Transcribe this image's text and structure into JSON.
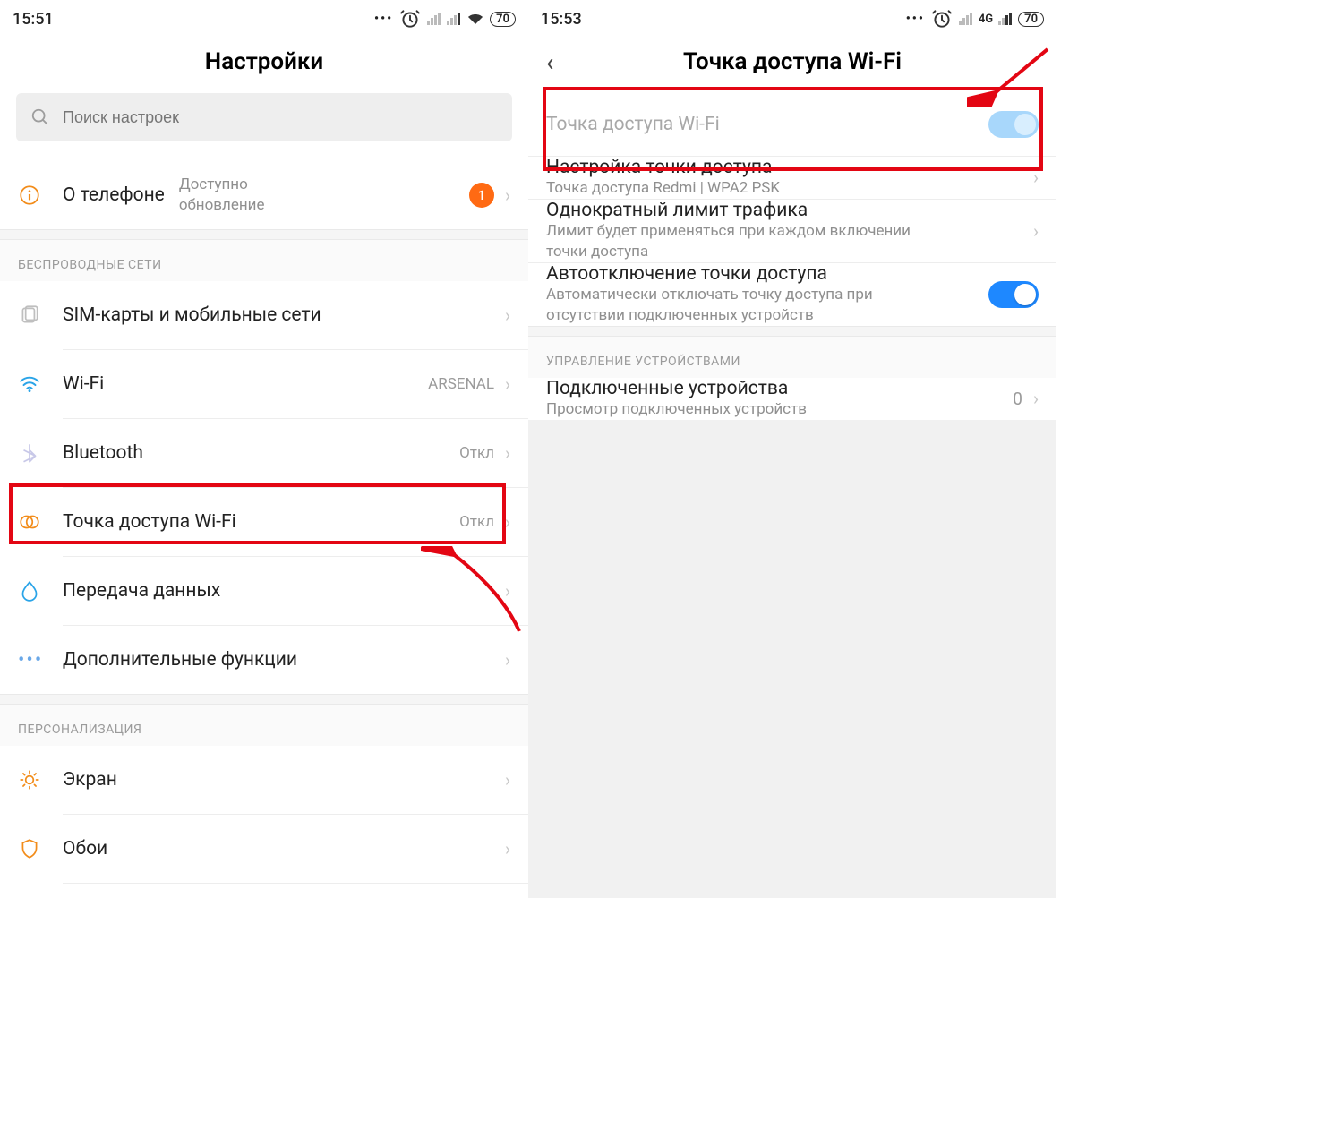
{
  "left": {
    "status": {
      "time": "15:51",
      "battery": "70"
    },
    "title": "Настройки",
    "search_placeholder": "Поиск настроек",
    "about": {
      "label": "О телефоне",
      "sub1": "Доступно",
      "sub2": "обновление",
      "badge": "1"
    },
    "section_wireless": "БЕСПРОВОДНЫЕ СЕТИ",
    "sim": "SIM-карты и мобильные сети",
    "wifi": {
      "label": "Wi-Fi",
      "value": "ARSENAL"
    },
    "bt": {
      "label": "Bluetooth",
      "value": "Откл"
    },
    "hotspot": {
      "label": "Точка доступа Wi-Fi",
      "value": "Откл"
    },
    "data": "Передача данных",
    "more": "Дополнительные функции",
    "section_personal": "ПЕРСОНАЛИЗАЦИЯ",
    "display": "Экран",
    "wallpaper": "Обои"
  },
  "right": {
    "status": {
      "time": "15:53",
      "battery": "70",
      "net": "4G"
    },
    "title": "Точка доступа Wi-Fi",
    "toggle_label": "Точка доступа Wi-Fi",
    "setup": {
      "label": "Настройка точки доступа",
      "sub": "Точка доступа Redmi | WPA2 PSK"
    },
    "limit": {
      "label": "Однократный лимит трафика",
      "sub": "Лимит будет применяться при каждом включении точки доступа"
    },
    "auto_off": {
      "label": "Автоотключение точки доступа",
      "sub": "Автоматически отключать точку доступа при отсутствии подключенных устройств"
    },
    "section_devices": "УПРАВЛЕНИЕ УСТРОЙСТВАМИ",
    "devices": {
      "label": "Подключенные устройства",
      "sub": "Просмотр подключенных устройств",
      "value": "0"
    }
  }
}
